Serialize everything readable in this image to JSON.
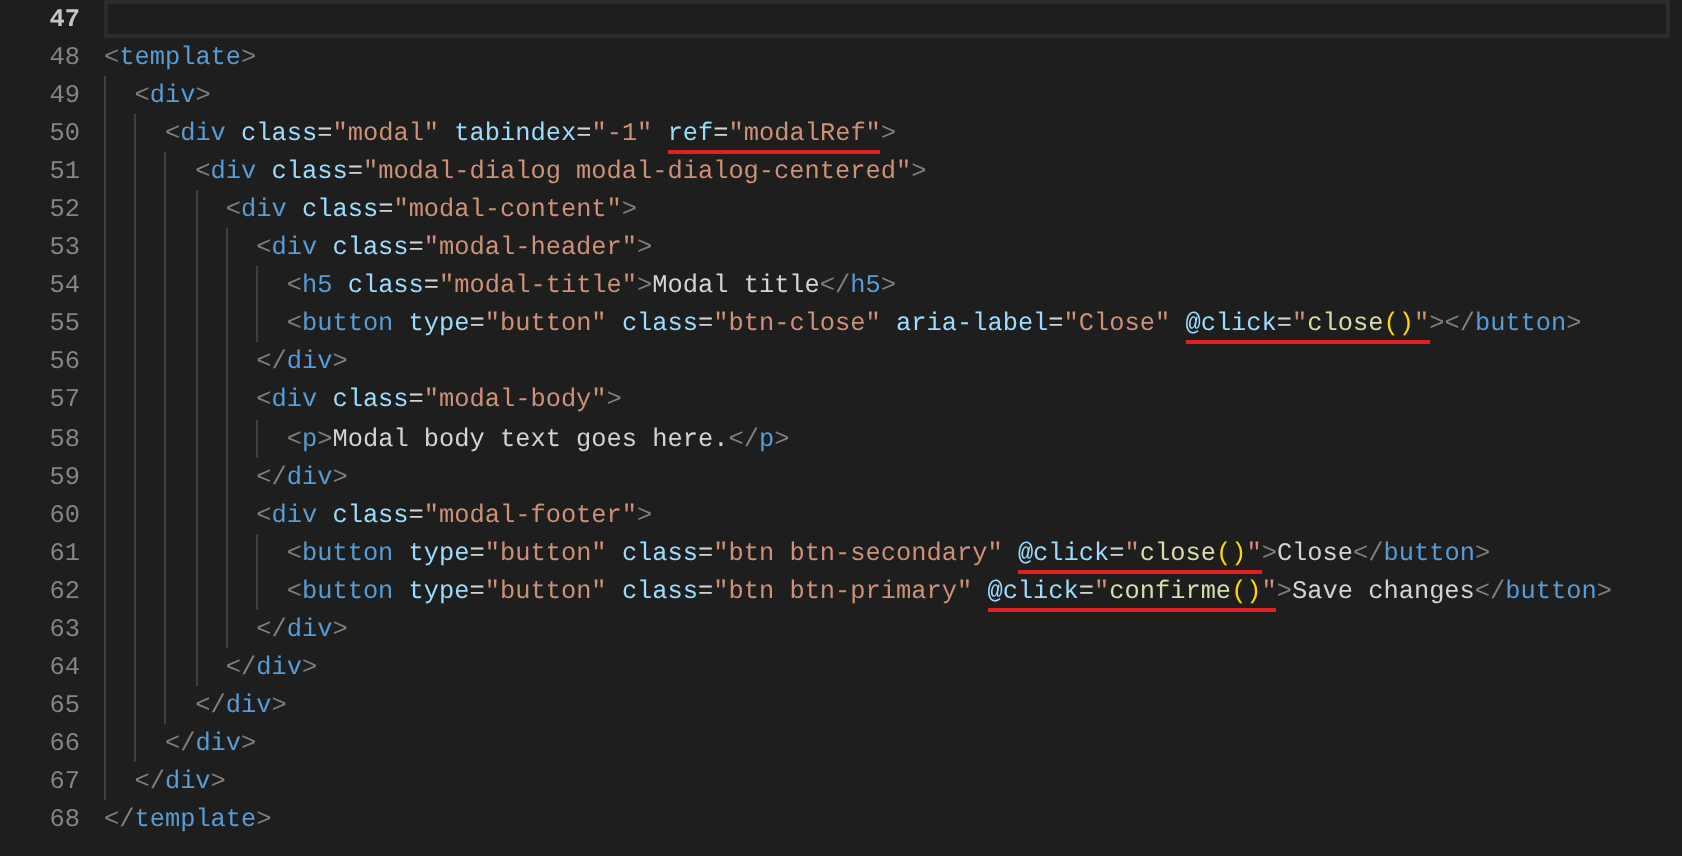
{
  "editor": {
    "lines": [
      {
        "number": "47",
        "current": true
      },
      {
        "number": "48",
        "current": false,
        "segments": [
          {
            "text": "<template>",
            "underlined": false
          }
        ]
      },
      {
        "number": "49",
        "current": false,
        "segments": [
          {
            "text": "  <div>",
            "underlined": false
          }
        ]
      },
      {
        "number": "50",
        "current": false,
        "segments": [
          {
            "text": "    <div class=\"modal\" tabindex=\"-1\" ",
            "underlined": false
          },
          {
            "text": "ref=\"modalRef\"",
            "underlined": true
          },
          {
            "text": ">",
            "underlined": false
          }
        ]
      },
      {
        "number": "51",
        "current": false,
        "segments": [
          {
            "text": "      <div class=\"modal-dialog modal-dialog-centered\">",
            "underlined": false
          }
        ]
      },
      {
        "number": "52",
        "current": false,
        "segments": [
          {
            "text": "        <div class=\"modal-content\">",
            "underlined": false
          }
        ]
      },
      {
        "number": "53",
        "current": false,
        "segments": [
          {
            "text": "          <div class=\"modal-header\">",
            "underlined": false
          }
        ]
      },
      {
        "number": "54",
        "current": false,
        "segments": [
          {
            "text": "            <h5 class=\"modal-title\">Modal title</h5>",
            "underlined": false
          }
        ]
      },
      {
        "number": "55",
        "current": false,
        "segments": [
          {
            "text": "            <button type=\"button\" class=\"btn-close\" aria-label=\"Close\" ",
            "underlined": false
          },
          {
            "text": "@click=\"close()\"",
            "underlined": true
          },
          {
            "text": "></button>",
            "underlined": false
          }
        ]
      },
      {
        "number": "56",
        "current": false,
        "segments": [
          {
            "text": "          </div>",
            "underlined": false
          }
        ]
      },
      {
        "number": "57",
        "current": false,
        "segments": [
          {
            "text": "          <div class=\"modal-body\">",
            "underlined": false
          }
        ]
      },
      {
        "number": "58",
        "current": false,
        "segments": [
          {
            "text": "            <p>Modal body text goes here.</p>",
            "underlined": false
          }
        ]
      },
      {
        "number": "59",
        "current": false,
        "segments": [
          {
            "text": "          </div>",
            "underlined": false
          }
        ]
      },
      {
        "number": "60",
        "current": false,
        "segments": [
          {
            "text": "          <div class=\"modal-footer\">",
            "underlined": false
          }
        ]
      },
      {
        "number": "61",
        "current": false,
        "segments": [
          {
            "text": "            <button type=\"button\" class=\"btn btn-secondary\" ",
            "underlined": false
          },
          {
            "text": "@click=\"close()\"",
            "underlined": true
          },
          {
            "text": ">Close</button>",
            "underlined": false
          }
        ]
      },
      {
        "number": "62",
        "current": false,
        "segments": [
          {
            "text": "            <button type=\"button\" class=\"btn btn-primary\" ",
            "underlined": false
          },
          {
            "text": "@click=\"confirme()\"",
            "underlined": true
          },
          {
            "text": ">Save changes</button>",
            "underlined": false
          }
        ]
      },
      {
        "number": "63",
        "current": false,
        "segments": [
          {
            "text": "          </div>",
            "underlined": false
          }
        ]
      },
      {
        "number": "64",
        "current": false,
        "segments": [
          {
            "text": "        </div>",
            "underlined": false
          }
        ]
      },
      {
        "number": "65",
        "current": false,
        "segments": [
          {
            "text": "      </div>",
            "underlined": false
          }
        ]
      },
      {
        "number": "66",
        "current": false,
        "segments": [
          {
            "text": "    </div>",
            "underlined": false
          }
        ]
      },
      {
        "number": "67",
        "current": false,
        "segments": [
          {
            "text": "  </div>",
            "underlined": false
          }
        ]
      },
      {
        "number": "68",
        "current": false,
        "segments": [
          {
            "text": "</template>",
            "underlined": false
          }
        ]
      }
    ]
  }
}
